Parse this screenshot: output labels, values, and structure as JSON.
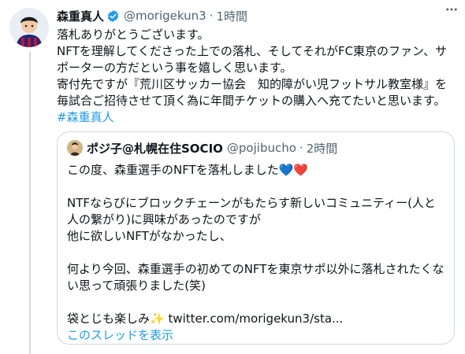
{
  "tweet": {
    "display_name": "森重真人",
    "handle": "@morigekun3",
    "time": "1時間",
    "lines": [
      "落札ありがとうございます。",
      "NFTを理解してくださった上での落札、そしてそれがFC東京のファン、サ",
      "ポーターの方だという事を嬉しく思います。",
      "寄付先ですが『荒川区サッカー協会　知的障がい児フットサル教室様』を",
      "毎試合ご招待させて頂く為に年間チケットの購入へ充てたいと思います。"
    ],
    "hashtag": "#森重真人"
  },
  "quote": {
    "display_name": "ポジ子@札幌在住SOCIO",
    "handle": "@pojibucho",
    "time": "2時間",
    "line1": "この度、森重選手のNFTを落札しました",
    "line1_emoji": "💙❤️",
    "lines_a": [
      "",
      "NTFならびにブロックチェーンがもたらす新しいコミュニティー(人と",
      "人の繋がり)に興味があったのですが",
      "他に欲しいNFTがなかったし、",
      "",
      "何より今回、森重選手の初めてのNFTを東京サポ以外に落札されたくな",
      "い思って頑張りました(笑)",
      ""
    ],
    "last_line_text": "袋とじも楽しみ",
    "last_line_emoji": "✨",
    "last_line_link": " twitter.com/morigekun3/sta...",
    "show_thread": "このスレッドを表示"
  },
  "icons": {
    "verified": "verified-badge-icon",
    "more": "more-options-icon"
  },
  "colors": {
    "accent": "#1d9bf0",
    "secondary_text": "#536471",
    "border": "#cfd9de"
  }
}
